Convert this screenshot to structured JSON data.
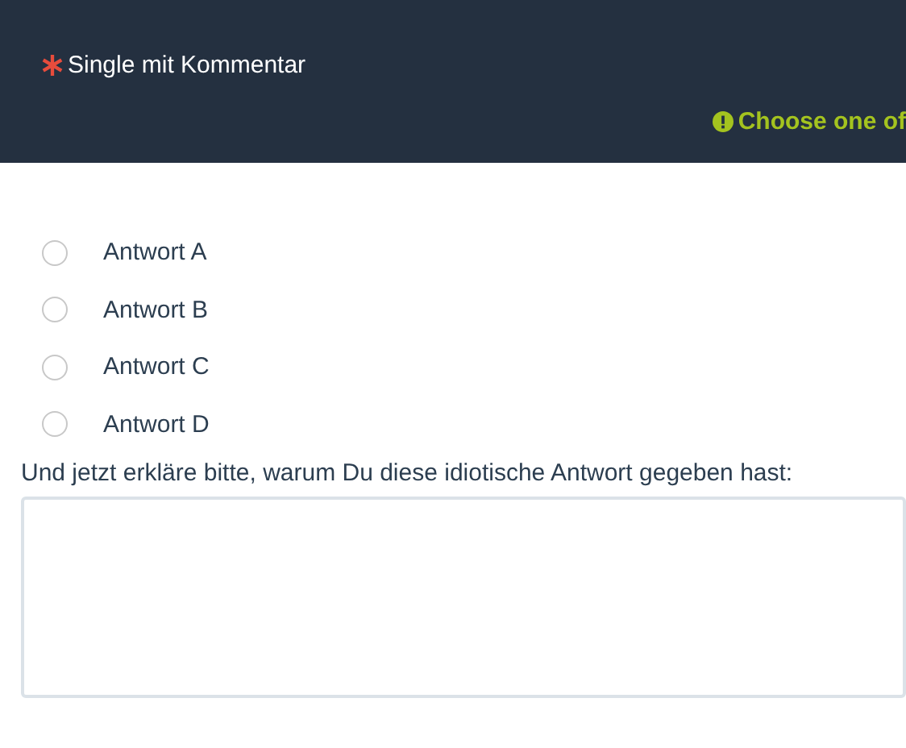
{
  "question": {
    "title": "Single mit Kommentar",
    "required": true,
    "hint": "Choose one of"
  },
  "options": [
    {
      "label": "Antwort A",
      "selected": false
    },
    {
      "label": "Antwort B",
      "selected": false
    },
    {
      "label": "Antwort C",
      "selected": false
    },
    {
      "label": "Antwort D",
      "selected": false
    }
  ],
  "comment": {
    "label": "Und jetzt erkläre bitte, warum Du diese idiotische Antwort gegeben hast:"
  }
}
